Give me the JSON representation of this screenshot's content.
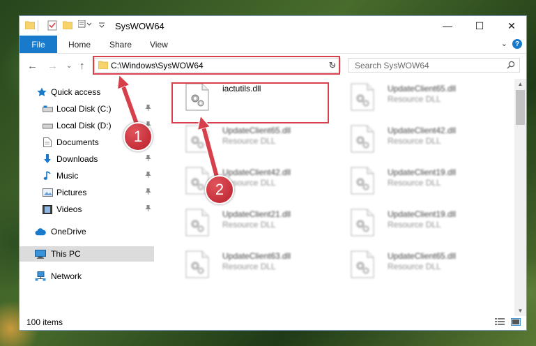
{
  "window": {
    "title": "SysWOW64",
    "minimize": "—",
    "maximize": "☐",
    "close": "✕"
  },
  "ribbon": {
    "tabs": [
      "File",
      "Home",
      "Share",
      "View"
    ],
    "expand": "⌄",
    "help": "?"
  },
  "address": {
    "path": "C:\\Windows\\SysWOW64",
    "dropdown": "⌄",
    "refresh": "↻"
  },
  "nav_buttons": {
    "back": "←",
    "forward": "→",
    "recent": "⌄",
    "up": "↑"
  },
  "search": {
    "placeholder": "Search SysWOW64",
    "icon": "⌕"
  },
  "sidebar": {
    "items": [
      {
        "label": "Quick access",
        "icon": "star-icon",
        "pinned": false,
        "selected": false
      },
      {
        "label": "Local Disk (C:)",
        "icon": "drive-icon",
        "pinned": true,
        "selected": false
      },
      {
        "label": "Local Disk (D:)",
        "icon": "drive-icon",
        "pinned": true,
        "selected": false
      },
      {
        "label": "Documents",
        "icon": "documents-icon",
        "pinned": true,
        "selected": false
      },
      {
        "label": "Downloads",
        "icon": "downloads-icon",
        "pinned": true,
        "selected": false
      },
      {
        "label": "Music",
        "icon": "music-icon",
        "pinned": true,
        "selected": false
      },
      {
        "label": "Pictures",
        "icon": "pictures-icon",
        "pinned": true,
        "selected": false
      },
      {
        "label": "Videos",
        "icon": "videos-icon",
        "pinned": true,
        "selected": false
      },
      {
        "label": "OneDrive",
        "icon": "onedrive-icon",
        "pinned": false,
        "selected": false
      },
      {
        "label": "This PC",
        "icon": "pc-icon",
        "pinned": false,
        "selected": true
      },
      {
        "label": "Network",
        "icon": "network-icon",
        "pinned": false,
        "selected": false
      }
    ],
    "pin_glyph": "📌"
  },
  "files": [
    {
      "name": "iactutils.dll",
      "type": "",
      "blurred": false
    },
    {
      "name": "UpdateClient65.dll",
      "type": "Resource DLL",
      "blurred": true
    },
    {
      "name": "UpdateClient65.dll",
      "type": "Resource DLL",
      "blurred": true
    },
    {
      "name": "UpdateClient42.dll",
      "type": "Resource DLL",
      "blurred": true
    },
    {
      "name": "UpdateClient42.dll",
      "type": "Resource DLL",
      "blurred": true
    },
    {
      "name": "UpdateClient19.dll",
      "type": "Resource DLL",
      "blurred": true
    },
    {
      "name": "UpdateClient21.dll",
      "type": "Resource DLL",
      "blurred": true
    },
    {
      "name": "UpdateClient19.dll",
      "type": "Resource DLL",
      "blurred": true
    },
    {
      "name": "UpdateClient63.dll",
      "type": "Resource DLL",
      "blurred": true
    },
    {
      "name": "UpdateClient65.dll",
      "type": "Resource DLL",
      "blurred": true
    }
  ],
  "status": {
    "item_count": "100 items"
  },
  "scroll": {
    "up": "▲",
    "down": "▼"
  },
  "annotations": {
    "step1": "1",
    "step2": "2",
    "color": "#d7404b"
  },
  "colors": {
    "accent": "#1979ca",
    "selection": "#dcdcdc",
    "annotation": "#d7404b"
  }
}
